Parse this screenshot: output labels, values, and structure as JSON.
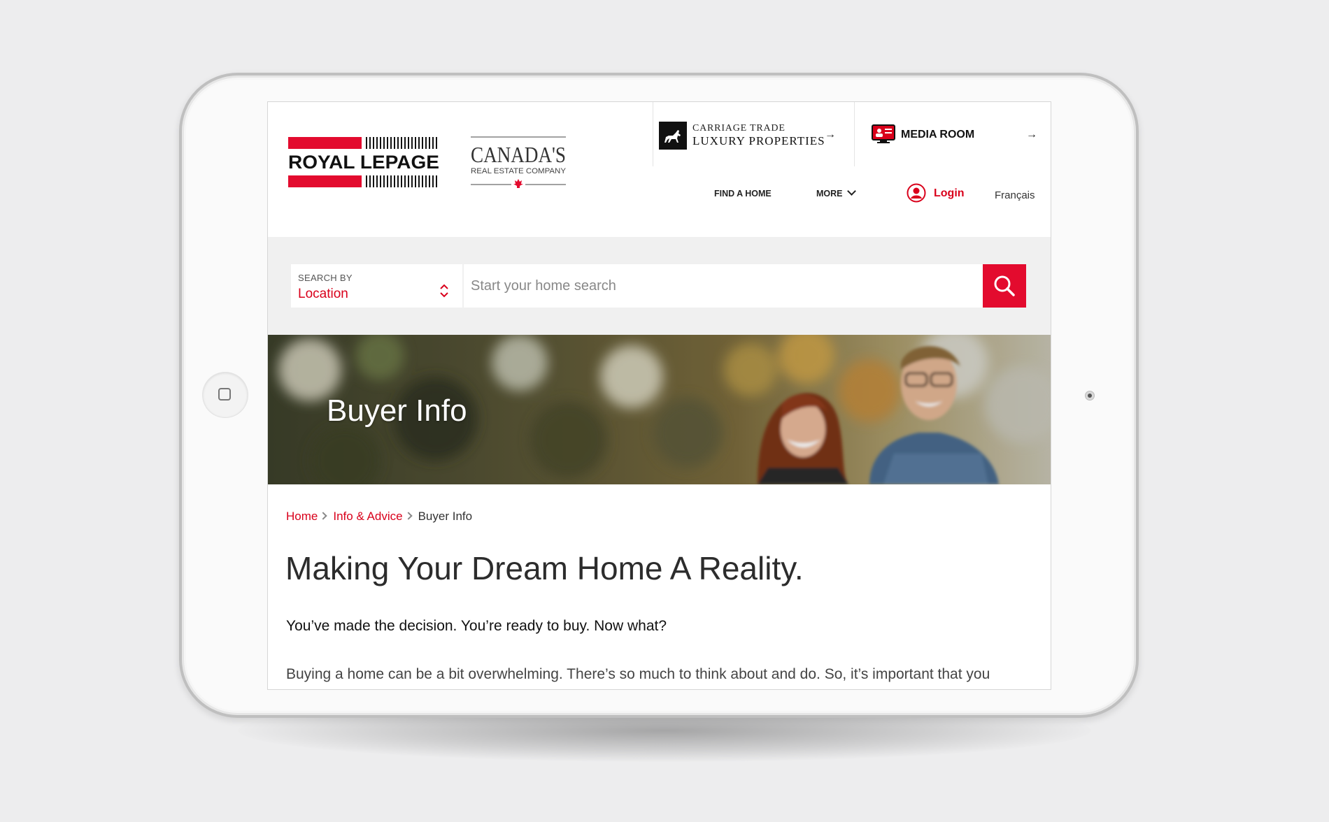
{
  "header": {
    "brand": "ROYAL LEPAGE",
    "tagline_line1": "CANADA'S",
    "tagline_line2": "REAL ESTATE COMPANY",
    "carriage_trade": {
      "line1": "CARRIAGE TRADE",
      "line2": "LUXURY PROPERTIES",
      "arrow": "→"
    },
    "media_room": {
      "label": "MEDIA ROOM",
      "arrow": "→"
    },
    "nav": {
      "find_home": "FIND A HOME",
      "more": "MORE"
    },
    "login": "Login",
    "language": "Français"
  },
  "search": {
    "search_by_label": "SEARCH BY",
    "search_by_value": "Location",
    "placeholder": "Start your home search"
  },
  "hero": {
    "title": "Buyer Info"
  },
  "breadcrumb": {
    "home": "Home",
    "info_advice": "Info & Advice",
    "current": "Buyer Info"
  },
  "content": {
    "headline": "Making Your Dream Home A Reality.",
    "lead": "You’ve made the decision. You’re ready to buy. Now what?",
    "body": "Buying a home can be a bit overwhelming. There’s so much to think about and do. So, it’s important that you"
  },
  "colors": {
    "brand_red": "#d9001b",
    "search_button": "#e30b2e",
    "search_band": "#f0f0f0"
  },
  "icons": {
    "carriage_trade": "horse-carriage-icon",
    "media_room": "media-screen-icon",
    "login": "user-circle-icon",
    "search": "search-icon",
    "select_arrows": "updown-chevron-icon",
    "home_button": "home-button-icon"
  }
}
